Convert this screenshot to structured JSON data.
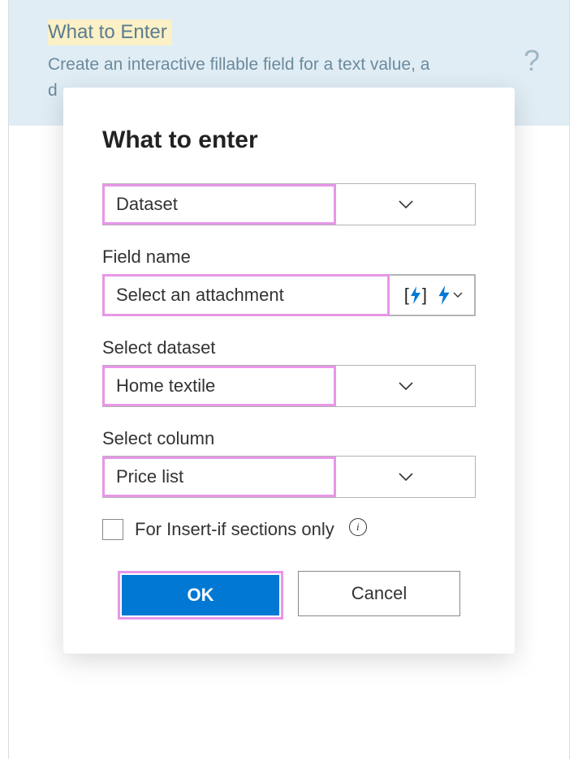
{
  "backdrop": {
    "title": "What to Enter",
    "description": "Create an interactive fillable field for a text value, a d",
    "help_symbol": "?"
  },
  "dialog": {
    "title": "What to enter",
    "type_field": {
      "value": "Dataset"
    },
    "field_name": {
      "label": "Field name",
      "value": "Select an attachment"
    },
    "select_dataset": {
      "label": "Select dataset",
      "value": "Home textile"
    },
    "select_column": {
      "label": "Select column",
      "value": "Price list"
    },
    "checkbox": {
      "label": "For Insert-if sections only"
    },
    "buttons": {
      "ok": "OK",
      "cancel": "Cancel"
    }
  }
}
